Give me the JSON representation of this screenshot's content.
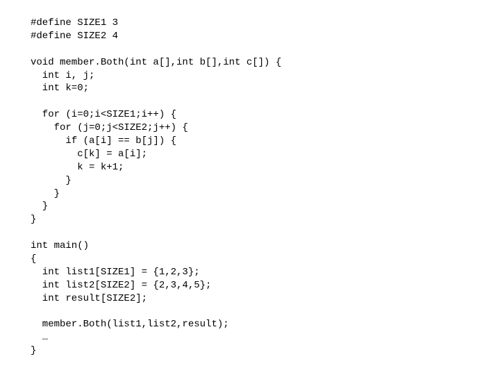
{
  "code": {
    "l1": "#define SIZE1 3",
    "l2": "#define SIZE2 4",
    "l3": "",
    "l4": "void member.Both(int a[],int b[],int c[]) {",
    "l5": "  int i, j;",
    "l6": "  int k=0;",
    "l7": "",
    "l8": "  for (i=0;i<SIZE1;i++) {",
    "l9": "    for (j=0;j<SIZE2;j++) {",
    "l10": "      if (a[i] == b[j]) {",
    "l11": "        c[k] = a[i];",
    "l12": "        k = k+1;",
    "l13": "      }",
    "l14": "    }",
    "l15": "  }",
    "l16": "}",
    "l17": "",
    "l18": "int main()",
    "l19": "{",
    "l20": "  int list1[SIZE1] = {1,2,3};",
    "l21": "  int list2[SIZE2] = {2,3,4,5};",
    "l22": "  int result[SIZE2];",
    "l23": "",
    "l24": "  member.Both(list1,list2,result);",
    "l25": "  …",
    "l26": "}"
  }
}
